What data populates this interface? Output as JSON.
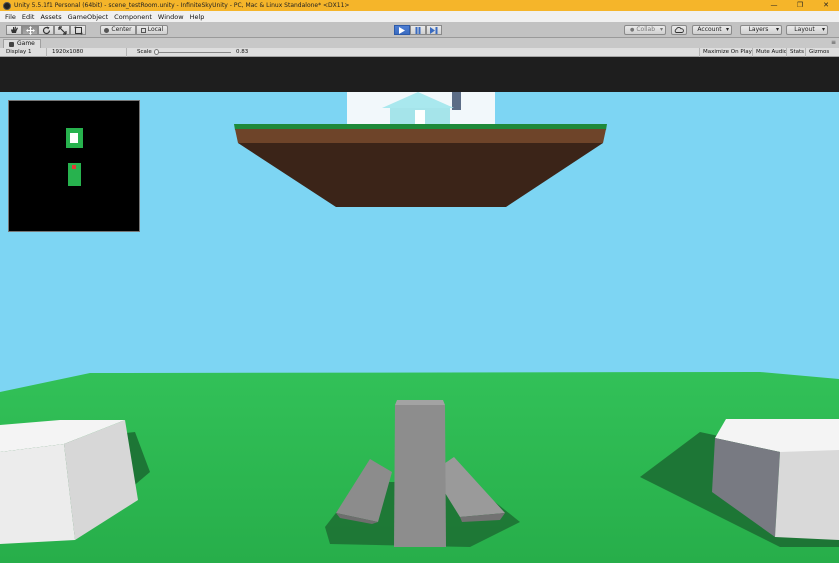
{
  "window": {
    "title": "Unity 5.5.1f1 Personal (64bit) - scene_testRoom.unity - InfiniteSkyUnity - PC, Mac & Linux Standalone* <DX11>",
    "minimize_glyph": "—",
    "maximize_glyph": "❐",
    "close_glyph": "✕"
  },
  "menubar": {
    "items": [
      "File",
      "Edit",
      "Assets",
      "GameObject",
      "Component",
      "Window",
      "Help"
    ]
  },
  "toolbar": {
    "pivot_label": "Center",
    "space_label": "Local",
    "collab_label": "Collab",
    "account_label": "Account",
    "layers_label": "Layers",
    "layout_label": "Layout",
    "play_state": "playing"
  },
  "game_tab": {
    "title": "Game",
    "menu_glyph": "≡"
  },
  "game_toolbar": {
    "display": "Display 1",
    "resolution": "1920x1080",
    "scale_label": "Scale",
    "scale_value": "0.83",
    "toggles": [
      "Maximize On Play",
      "Mute Audio",
      "Stats",
      "Gizmos"
    ]
  },
  "colors": {
    "title_bar": "#f5b52a",
    "sky": "#7dd5f3",
    "ground": "#2fbf52",
    "island_dirt": "#3b2418",
    "play_active": "#3a6bc0"
  },
  "icons": [
    "unity-logo-icon",
    "hand-tool-icon",
    "move-tool-icon",
    "rotate-tool-icon",
    "scale-tool-icon",
    "rect-tool-icon",
    "play-icon",
    "pause-icon",
    "step-icon",
    "cloud-icon",
    "game-view-icon"
  ]
}
